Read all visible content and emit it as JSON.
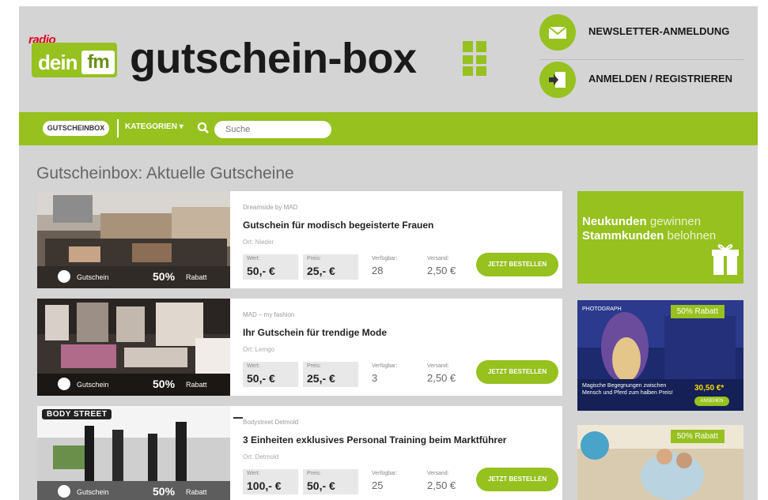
{
  "header": {
    "logo_radio": "radio",
    "logo_dein": "dein",
    "logo_fm": "fm",
    "site_title": "gutschein-box",
    "newsletter_label": "NEWSLETTER-ANMELDUNG",
    "login_label": "ANMELDEN / REGISTRIEREN"
  },
  "nav": {
    "home_label": "GUTSCHEINBOX",
    "categories_label": "KATEGORIEN",
    "search_placeholder": "Suche"
  },
  "section_title": "Gutscheinbox: Aktuelle Gutscheine",
  "card_common": {
    "tag_label": "Gutschein",
    "discount_value": "50%",
    "discount_label": "Rabatt",
    "stat_labels": {
      "wert": "Wert:",
      "preis": "Preis:",
      "verfuegbar": "Verfügbar:",
      "versand": "Versand:"
    },
    "button_label": "JETZT BESTELLEN"
  },
  "cards": [
    {
      "merchant": "Dreamside by MAD",
      "title": "Gutschein für modisch begeisterte Frauen",
      "ort": "Ort: Nieder",
      "wert": "50,- €",
      "preis": "25,- €",
      "verfuegbar": "28",
      "versand": "2,50 €"
    },
    {
      "merchant": "MAD – my fashion",
      "title": "Ihr Gutschein für trendige Mode",
      "ort": "Ort: Lemgo",
      "wert": "50,- €",
      "preis": "25,- €",
      "verfuegbar": "3",
      "versand": "2,50 €"
    },
    {
      "merchant": "Bodystreet Detmold",
      "title": "3 Einheiten exklusives Personal Training beim Marktführer",
      "ort": "Ort: Detmold",
      "wert": "100,- €",
      "preis": "50,- €",
      "verfuegbar": "25",
      "versand": "2,50 €",
      "brand_badge": "BODY STREET"
    }
  ],
  "sidebar": {
    "promo_line1_bold": "Neukunden",
    "promo_line1_thin": "gewinnen",
    "promo_line2_bold": "Stammkunden",
    "promo_line2_thin": "belohnen",
    "ad1_badge": "50% Rabatt",
    "ad1_brand": "PHOTOGRAPH",
    "ad1_text": "Magische Begegnungen zwischen Mensch und Pferd zum halben Preis!",
    "ad1_price": "30,50 €*",
    "ad1_button": "ANSEHEN",
    "ad2_badge": "50% Rabatt"
  },
  "colors": {
    "brand_green": "#96c11f",
    "page_bg": "#d4d4d4",
    "card_bg": "#ffffff"
  }
}
